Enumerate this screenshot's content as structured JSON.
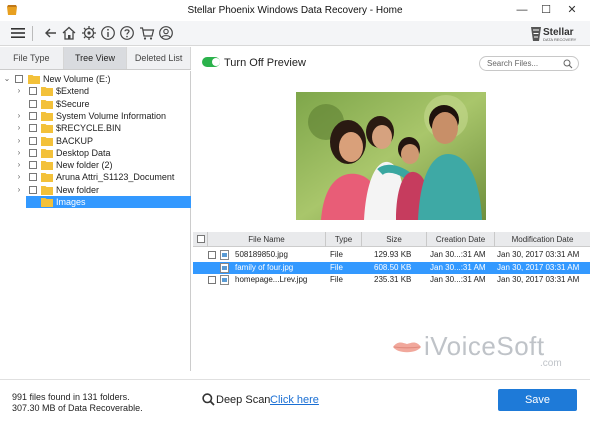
{
  "window": {
    "title": "Stellar Phoenix Windows Data Recovery - Home",
    "minimize": "—",
    "maximize": "☐",
    "close": "✕"
  },
  "toolbar": {
    "icons": [
      "menu-icon",
      "back-icon",
      "home-icon",
      "settings-icon",
      "info-icon",
      "help-icon",
      "cart-icon",
      "user-icon"
    ],
    "logo": "Stellar",
    "logo_sub": "DATA RECOVERY"
  },
  "tabs": [
    {
      "label": "File Type",
      "active": false
    },
    {
      "label": "Tree View",
      "active": true
    },
    {
      "label": "Deleted List",
      "active": false
    }
  ],
  "tree": {
    "root": "New Volume (E:)",
    "items": [
      {
        "label": "$Extend",
        "expandable": true
      },
      {
        "label": "$Secure",
        "expandable": false
      },
      {
        "label": "System Volume Information",
        "expandable": true
      },
      {
        "label": "$RECYCLE.BIN",
        "expandable": true
      },
      {
        "label": "BACKUP",
        "expandable": true
      },
      {
        "label": "Desktop Data",
        "expandable": true
      },
      {
        "label": "New folder (2)",
        "expandable": true
      },
      {
        "label": "Aruna Attri_S1123_Document",
        "expandable": true
      },
      {
        "label": "New folder",
        "expandable": true
      },
      {
        "label": "Images",
        "expandable": false,
        "selected": true
      }
    ]
  },
  "preview": {
    "toggle_label": "Turn Off Preview",
    "toggle_on": true,
    "search_placeholder": "Search Files..."
  },
  "table": {
    "columns": [
      "File Name",
      "Type",
      "Size",
      "Creation Date",
      "Modification Date"
    ],
    "rows": [
      {
        "name": "508189850.jpg",
        "type": "File",
        "size": "129.93 KB",
        "created": "Jan 30...:31 AM",
        "modified": "Jan 30, 2017 03:31 AM",
        "selected": false
      },
      {
        "name": "family of four.jpg",
        "type": "File",
        "size": "608.50 KB",
        "created": "Jan 30...:31 AM",
        "modified": "Jan 30, 2017 03:31 AM",
        "selected": true
      },
      {
        "name": "homepage...Lrev.jpg",
        "type": "File",
        "size": "235.31 KB",
        "created": "Jan 30...:31 AM",
        "modified": "Jan 30, 2017 03:31 AM",
        "selected": false
      }
    ]
  },
  "watermark": {
    "text": "iVoiceSoft",
    "sub": ".com"
  },
  "footer": {
    "status_line1": "991 files found in 131 folders.",
    "status_line2": "307.30 MB of Data Recoverable.",
    "deep_scan_label": "Deep Scan",
    "deep_scan_link": "Click here",
    "save_label": "Save"
  },
  "colors": {
    "accent": "#1e7ad8",
    "selection": "#3399ff",
    "toggle": "#2bb24c",
    "folder": "#f3c13a"
  }
}
